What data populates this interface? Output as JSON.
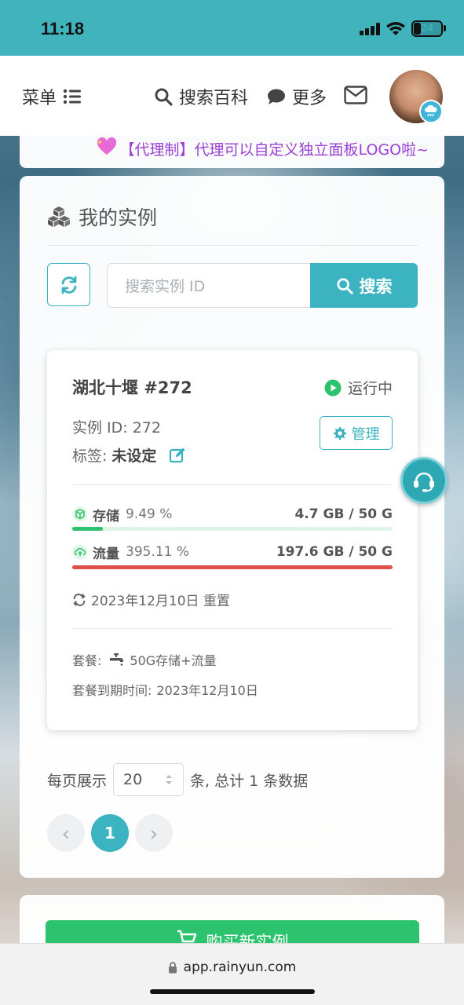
{
  "status_bar": {
    "time": "11:18",
    "battery": "24"
  },
  "nav": {
    "menu_label": "菜单",
    "search_label": "搜索百科",
    "more_label": "更多"
  },
  "announcement": {
    "text": "【代理制】代理可以自定义独立面板LOGO啦~"
  },
  "instances_panel": {
    "title": "我的实例",
    "search_placeholder": "搜索实例 ID",
    "search_button": "搜索"
  },
  "instance": {
    "name": "湖北十堰 #272",
    "status": "运行中",
    "id_label": "实例 ID: 272",
    "tag_label": "标签:",
    "tag_value": "未设定",
    "manage_button": "管理",
    "storage": {
      "label": "存储",
      "percent_text": "9.49 %",
      "percent": 9.49,
      "amount": "4.7 GB / 50 G",
      "color": "#2dc26e"
    },
    "traffic": {
      "label": "流量",
      "percent_text": "395.11 %",
      "percent": 100,
      "amount": "197.6 GB / 50 G",
      "color": "#e0504a"
    },
    "reset_text": "2023年12月10日 重置",
    "plan_label": "套餐:",
    "plan_value": "50G存储+流量",
    "expiry_label": "套餐到期时间:",
    "expiry_value": "2023年12月10日"
  },
  "pagination": {
    "per_page_label": "每页展示",
    "per_page_value": "20",
    "total_text": "条, 总计 1 条数据",
    "current_page": "1",
    "prev_symbol": "‹",
    "next_symbol": "›"
  },
  "buy": {
    "label": "购买新实例"
  },
  "browser": {
    "url": "app.rainyun.com"
  },
  "colors": {
    "accent": "#3bb3c0",
    "status_bar": "#40b3bd",
    "running": "#2dc26e"
  }
}
